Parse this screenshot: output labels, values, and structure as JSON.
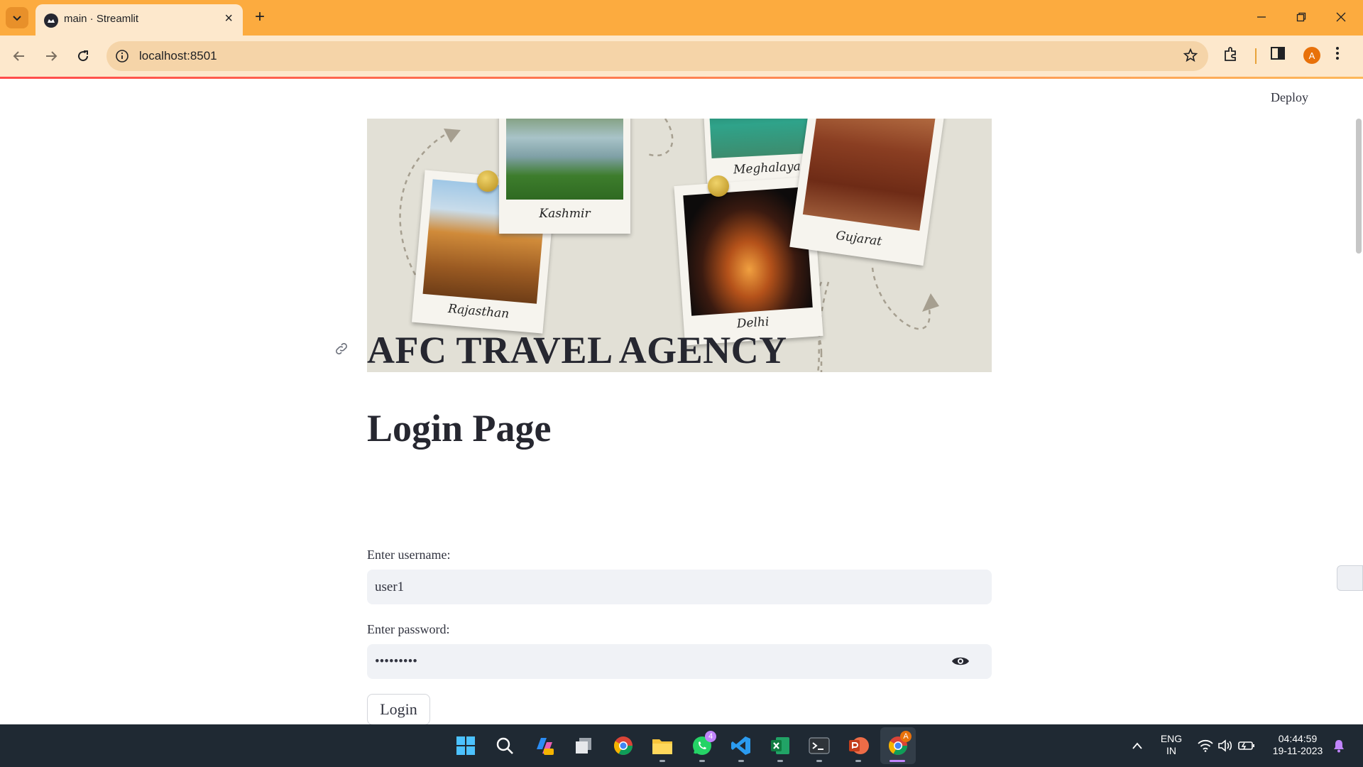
{
  "browser": {
    "tab_title": "main · Streamlit",
    "url": "localhost:8501",
    "profile_initial": "A"
  },
  "app": {
    "deploy_label": "Deploy",
    "title": "AFC TRAVEL AGENCY",
    "subtitle": "Login Page",
    "username_label": "Enter username:",
    "username_value": "user1",
    "password_label": "Enter password:",
    "password_value": "•••••••••",
    "login_label": "Login"
  },
  "hero_image": {
    "captions": [
      "Kashmir",
      "Meghalaya",
      "Rajasthan",
      "Delhi",
      "Gujarat"
    ]
  },
  "taskbar": {
    "whatsapp_badge": "4",
    "chrome_badge": "A",
    "language_line1": "ENG",
    "language_line2": "IN",
    "time": "04:44:59",
    "date": "19-11-2023"
  },
  "colors": {
    "tab_strip": "#fcab3f",
    "toolbar": "#fde8cc",
    "text": "#262730",
    "input_bg": "#f0f2f6",
    "taskbar": "#1f2933"
  }
}
